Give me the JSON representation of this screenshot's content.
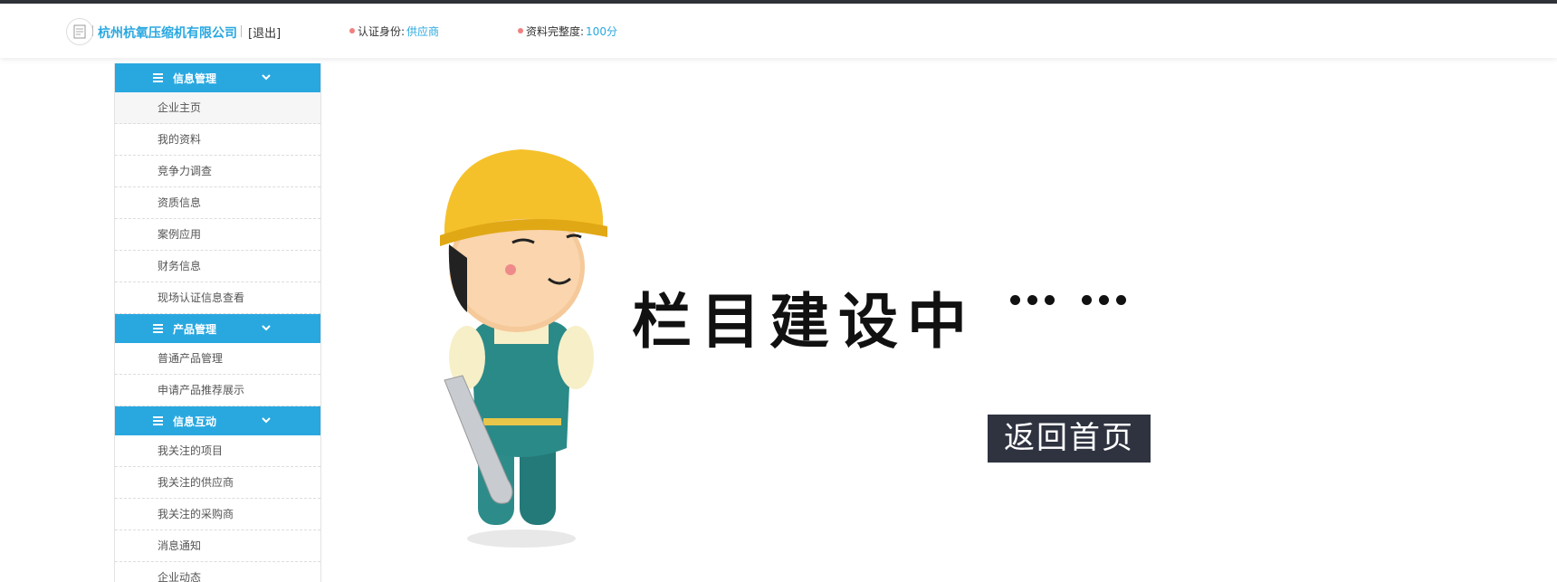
{
  "header": {
    "company_name": "杭州杭氧压缩机有限公司",
    "logout_label": "[退出]",
    "cert_label": "认证身份:",
    "cert_value": "供应商",
    "completeness_label": "资料完整度:",
    "completeness_value": "100分"
  },
  "sidebar": {
    "sections": [
      {
        "title": "信息管理",
        "items": [
          "企业主页",
          "我的资料",
          "竞争力调查",
          "资质信息",
          "案例应用",
          "财务信息",
          "现场认证信息查看"
        ]
      },
      {
        "title": "产品管理",
        "items": [
          "普通产品管理",
          "申请产品推荐展示"
        ]
      },
      {
        "title": "信息互动",
        "items": [
          "我关注的项目",
          "我关注的供应商",
          "我关注的采购商",
          "消息通知",
          "企业动态"
        ]
      }
    ]
  },
  "content": {
    "banner_text": "栏目建设中",
    "home_button": "返回首页"
  },
  "colors": {
    "accent": "#29a8e0",
    "topline": "#2f3338",
    "button_bg": "#2f3340",
    "dot": "#f08080"
  },
  "icons": [
    "menu-icon",
    "chevron-down-icon"
  ]
}
